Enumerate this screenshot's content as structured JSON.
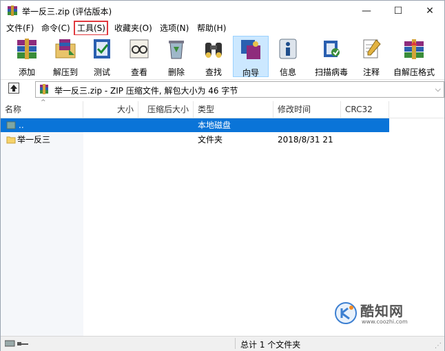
{
  "window": {
    "title": "举一反三.zip (评估版本)",
    "controls": {
      "minimize": "—",
      "maximize": "☐",
      "close": "✕"
    }
  },
  "menu": [
    {
      "label": "文件(F)"
    },
    {
      "label": "命令(C)"
    },
    {
      "label": "工具(S)",
      "highlighted": true
    },
    {
      "label": "收藏夹(O)"
    },
    {
      "label": "选项(N)"
    },
    {
      "label": "帮助(H)"
    }
  ],
  "toolbar": [
    {
      "label": "添加",
      "icon": "books-icon"
    },
    {
      "label": "解压到",
      "icon": "extract-folder-icon"
    },
    {
      "label": "测试",
      "icon": "test-icon"
    },
    {
      "label": "查看",
      "icon": "glasses-book-icon"
    },
    {
      "label": "删除",
      "icon": "recycle-icon"
    },
    {
      "label": "查找",
      "icon": "binoculars-icon"
    },
    {
      "label": "向导",
      "icon": "wizard-icon",
      "active": true
    },
    {
      "label": "信息",
      "icon": "info-icon"
    },
    {
      "label": "扫描病毒",
      "icon": "virus-scan-icon"
    },
    {
      "label": "注释",
      "icon": "comment-icon"
    },
    {
      "label": "自解压格式",
      "icon": "sfx-icon"
    }
  ],
  "address": {
    "path": "举一反三.zip - ZIP 压缩文件, 解包大小为 46 字节"
  },
  "columns": [
    "名称",
    "大小",
    "压缩后大小",
    "类型",
    "修改时间",
    "CRC32"
  ],
  "rows": [
    {
      "name": "..",
      "size": "",
      "packed": "",
      "type": "本地磁盘",
      "modified": "",
      "crc": "",
      "selected": true,
      "icon": "drive-icon"
    },
    {
      "name": "举一反三",
      "size": "",
      "packed": "",
      "type": "文件夹",
      "modified": "2018/8/31 21",
      "crc": "",
      "selected": false,
      "icon": "folder-icon"
    }
  ],
  "status": {
    "text": "总计 1 个文件夹"
  },
  "watermark": {
    "name": "酷知网",
    "url": "www.coozhi.com"
  },
  "colors": {
    "selection": "#0a74d8",
    "highlight_box": "#e0393e",
    "active_button": "#cce8ff"
  }
}
